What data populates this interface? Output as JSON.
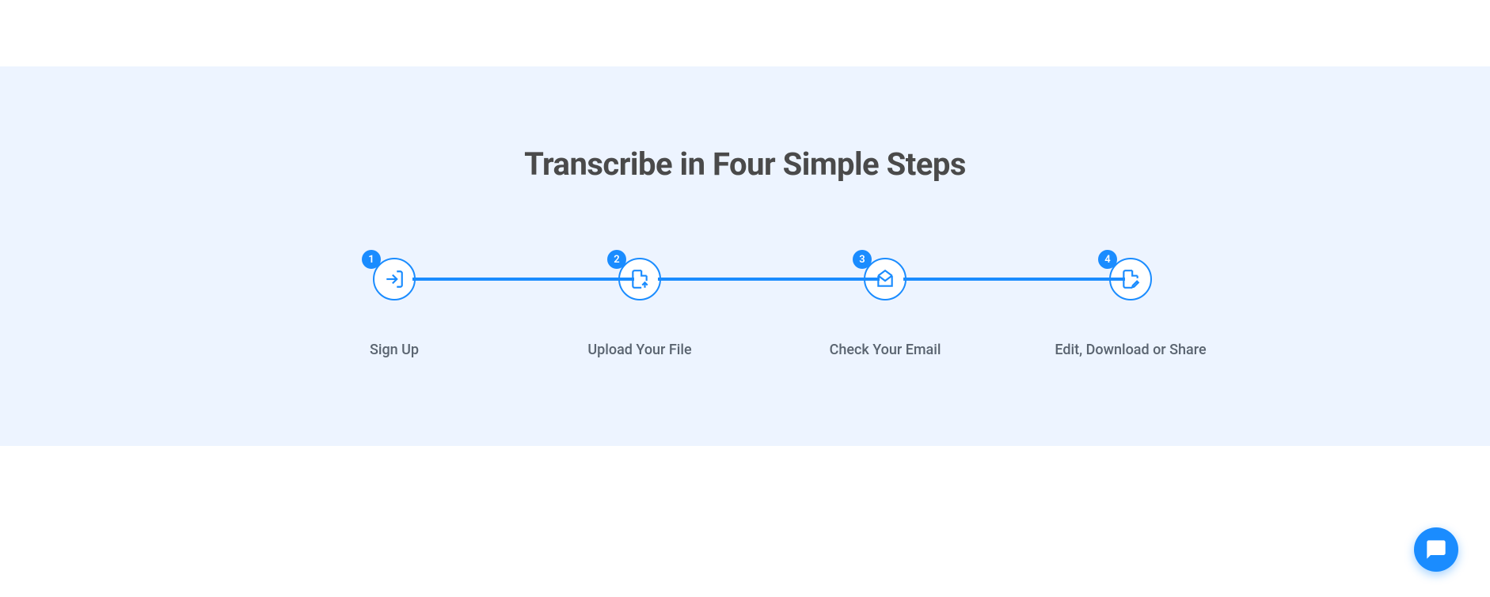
{
  "title": "Transcribe in Four Simple Steps",
  "steps": [
    {
      "number": "1",
      "label": "Sign Up"
    },
    {
      "number": "2",
      "label": "Upload Your File"
    },
    {
      "number": "3",
      "label": "Check Your Email"
    },
    {
      "number": "4",
      "label": "Edit, Download or Share"
    }
  ]
}
